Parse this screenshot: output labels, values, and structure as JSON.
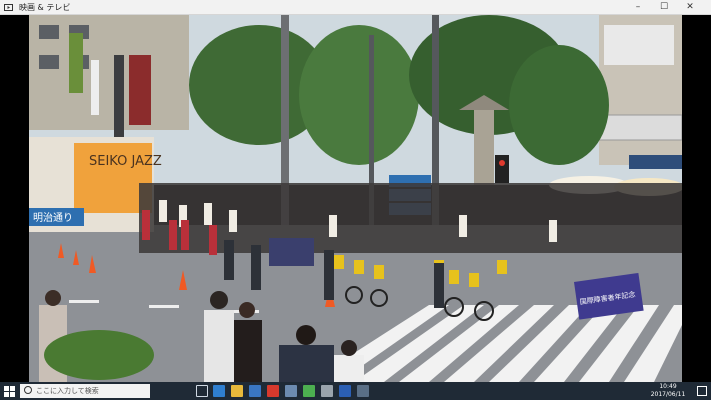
{
  "window": {
    "title": "映画 & テレビ",
    "minimize": "–",
    "maximize": "☐",
    "close": "✕"
  },
  "video": {
    "description_colors": {
      "sky": "#d9e4ea",
      "asphalt": "#8e9196",
      "crosswalk": "#f2f2f2",
      "trees": "#3f6a35"
    },
    "signs": {
      "shop_sign": "SEIKO JAZZ",
      "direction_sign": "明治通り",
      "banner": "国際障害者年記念"
    }
  },
  "taskbar": {
    "search_placeholder": "ここに入力して検索",
    "clock_time": "10:49",
    "clock_date": "2017/06/11",
    "apps": [
      "task-view-icon",
      "edge-icon",
      "file-explorer-icon",
      "store-icon",
      "mcafee-icon",
      "mail-icon",
      "chrome-icon",
      "settings-icon",
      "word-icon",
      "video-app-icon"
    ]
  }
}
